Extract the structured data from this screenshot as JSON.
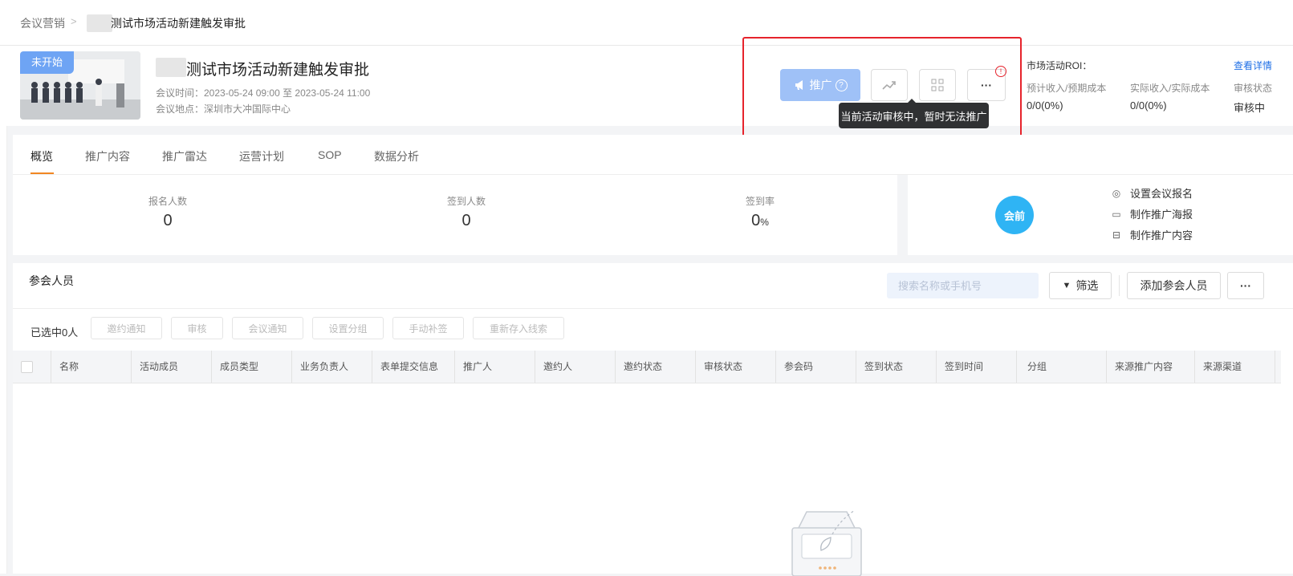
{
  "breadcrumb": {
    "root": "会议营销",
    "separator": ">",
    "current": "测试市场活动新建触发审批"
  },
  "event": {
    "status_badge": "未开始",
    "title": "测试市场活动新建触发审批",
    "time": "会议时间：2023-05-24 09:00 至 2023-05-24 11:00",
    "location": "会议地点：深圳市大冲国际中心"
  },
  "actions": {
    "promote_label": "推广",
    "promote_help": "?",
    "more_label": "···",
    "alert": "!",
    "tooltip": "当前活动审核中，暂时无法推广"
  },
  "roi": {
    "title": "市场活动ROI：",
    "link": "查看详情",
    "labels": [
      "预计收入/预期成本",
      "实际收入/实际成本",
      "审核状态"
    ],
    "values": [
      "0/0(0%)",
      "0/0(0%)",
      "审核中"
    ]
  },
  "tabs": [
    "概览",
    "推广内容",
    "推广雷达",
    "运营计划",
    "SOP",
    "数据分析"
  ],
  "stats": [
    {
      "label": "报名人数",
      "value": "0"
    },
    {
      "label": "签到人数",
      "value": "0"
    },
    {
      "label": "签到率",
      "value": "0",
      "unit": "%"
    }
  ],
  "phase": {
    "circle": "会前",
    "items": [
      {
        "icon": "gear-icon",
        "label": "设置会议报名"
      },
      {
        "icon": "image-icon",
        "label": "制作推广海报"
      },
      {
        "icon": "inbox-icon",
        "label": "制作推广内容"
      }
    ]
  },
  "participants": {
    "title": "参会人员",
    "search_placeholder": "搜索名称或手机号",
    "filter_label": "筛选",
    "add_label": "添加参会人员",
    "more_label": "···",
    "selected": "已选中0人",
    "bulk_actions": [
      "邀约通知",
      "审核",
      "会议通知",
      "设置分组",
      "手动补签",
      "重新存入线索"
    ],
    "columns": [
      "名称",
      "活动成员",
      "成员类型",
      "业务负责人",
      "表单提交信息",
      "推广人",
      "邀约人",
      "邀约状态",
      "审核状态",
      "参会码",
      "签到状态",
      "签到时间",
      "分组",
      "来源推广内容",
      "来源渠道"
    ]
  },
  "colors": {
    "accent": "#1f6fe6",
    "promote_disabled": "#9fc1f7",
    "phase_circle": "#2fb4f4",
    "tab_active": "#f18722",
    "highlight": "#e6232c"
  }
}
